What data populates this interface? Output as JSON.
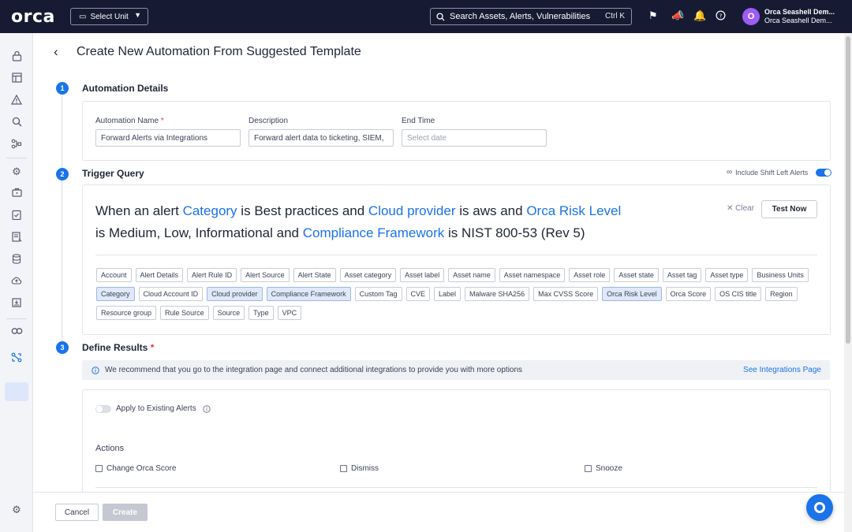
{
  "topbar": {
    "logo": "orca",
    "select_unit": "Select Unit",
    "search_placeholder": "Search Assets, Alerts, Vulnerabilities",
    "search_shortcut": "Ctrl K",
    "avatar_initial": "O",
    "org_name": "Orca Seashell Dem...",
    "org_sub": "Orca Seashell Dem..."
  },
  "page": {
    "title": "Create New Automation From Suggested Template"
  },
  "steps": {
    "one": "1",
    "two": "2",
    "three": "3"
  },
  "details": {
    "title": "Automation Details",
    "name_label": "Automation Name",
    "name_value": "Forward Alerts via Integrations",
    "description_label": "Description",
    "description_value": "Forward alert data to ticketing, SIEM,",
    "end_time_label": "End Time",
    "end_time_placeholder": "Select date"
  },
  "trigger": {
    "title": "Trigger Query",
    "shift_left_label": "Include Shift Left Alerts",
    "clear_label": "Clear",
    "test_now_label": "Test Now",
    "query": {
      "p1": "When an alert",
      "k1": "Category",
      "p2": "is",
      "v1": "Best practices",
      "p3": "and",
      "k2": "Cloud provider",
      "p4": "is",
      "v2": "aws",
      "p5": "and",
      "k3": "Orca Risk Level",
      "p6": "is",
      "v3": "Medium, Low, Informational",
      "p7": "and",
      "k4": "Compliance Framework",
      "p8": "is",
      "v4": "NIST 800-53 (Rev 5)"
    },
    "chips": [
      {
        "label": "Account",
        "selected": false
      },
      {
        "label": "Alert Details",
        "selected": false
      },
      {
        "label": "Alert Rule ID",
        "selected": false
      },
      {
        "label": "Alert Source",
        "selected": false
      },
      {
        "label": "Alert State",
        "selected": false
      },
      {
        "label": "Asset category",
        "selected": false
      },
      {
        "label": "Asset label",
        "selected": false
      },
      {
        "label": "Asset name",
        "selected": false
      },
      {
        "label": "Asset namespace",
        "selected": false
      },
      {
        "label": "Asset role",
        "selected": false
      },
      {
        "label": "Asset state",
        "selected": false
      },
      {
        "label": "Asset tag",
        "selected": false
      },
      {
        "label": "Asset type",
        "selected": false
      },
      {
        "label": "Business Units",
        "selected": false
      },
      {
        "label": "Category",
        "selected": true
      },
      {
        "label": "Cloud Account ID",
        "selected": false
      },
      {
        "label": "Cloud provider",
        "selected": true
      },
      {
        "label": "Compliance Framework",
        "selected": true
      },
      {
        "label": "Custom Tag",
        "selected": false
      },
      {
        "label": "CVE",
        "selected": false
      },
      {
        "label": "Label",
        "selected": false
      },
      {
        "label": "Malware SHA256",
        "selected": false
      },
      {
        "label": "Max CVSS Score",
        "selected": false
      },
      {
        "label": "Orca Risk Level",
        "selected": true
      },
      {
        "label": "Orca Score",
        "selected": false
      },
      {
        "label": "OS CIS title",
        "selected": false
      },
      {
        "label": "Region",
        "selected": false
      },
      {
        "label": "Resource group",
        "selected": false
      },
      {
        "label": "Rule Source",
        "selected": false
      },
      {
        "label": "Source",
        "selected": false
      },
      {
        "label": "Type",
        "selected": false
      },
      {
        "label": "VPC",
        "selected": false
      }
    ]
  },
  "results": {
    "title": "Define Results",
    "info_text": "We recommend that you go to the integration page and connect additional integrations to provide you with more options",
    "info_link": "See Integrations Page",
    "apply_label": "Apply to Existing Alerts",
    "actions_label": "Actions",
    "actions": [
      "Change Orca Score",
      "Dismiss",
      "Snooze"
    ]
  },
  "footer": {
    "cancel_label": "Cancel",
    "create_label": "Create"
  },
  "colors": {
    "topbar": "#161b33",
    "accent": "#1a73e8",
    "avatar": "#9d5cf5"
  }
}
